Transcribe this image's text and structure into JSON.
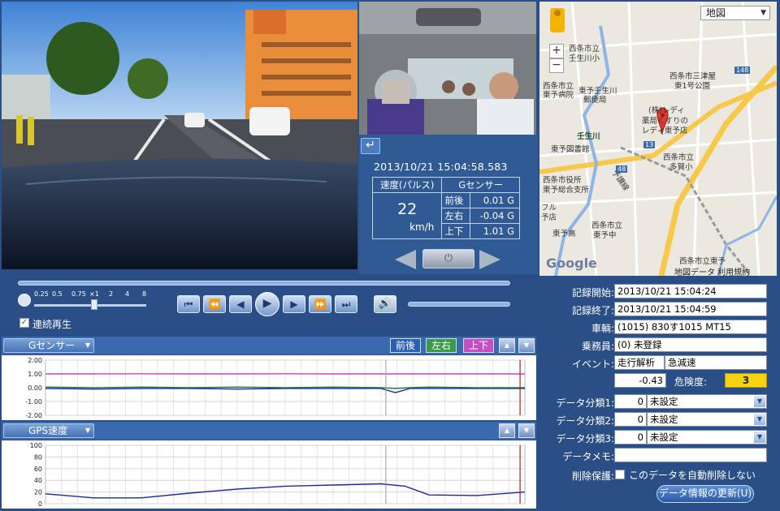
{
  "info": {
    "datetime": "2013/10/21   15:04:58.583",
    "speed_header": "速度(パルス)",
    "speed_value": "22",
    "speed_unit": "km/h",
    "gsensor_header": "Gセンサー",
    "rows": [
      {
        "label": "前後",
        "value": "0.01 G"
      },
      {
        "label": "左右",
        "value": "-0.04 G"
      },
      {
        "label": "上下",
        "value": "1.01 G"
      }
    ],
    "back_icon": "return-arrow-icon",
    "home_icon": "power-icon"
  },
  "map": {
    "type_select": "地図",
    "zoom_in": "+",
    "zoom_out": "−",
    "labels": [
      {
        "text": "西条市立"
      },
      {
        "text": "壬生川小"
      },
      {
        "text": "西条市立"
      },
      {
        "text": "東予病院"
      },
      {
        "text": "東予壬生川"
      },
      {
        "text": "郵便局"
      },
      {
        "text": "西条市三津屋"
      },
      {
        "text": "東1号公園"
      },
      {
        "text": "(株)レディ"
      },
      {
        "text": "薬局くすりの"
      },
      {
        "text": "レディ東予店"
      },
      {
        "text": "壬生川"
      },
      {
        "text": "東予図書館"
      },
      {
        "text": "西条市立"
      },
      {
        "text": "多賀小"
      },
      {
        "text": "西条市役所"
      },
      {
        "text": "東予総合支所"
      },
      {
        "text": "フル"
      },
      {
        "text": "予店"
      },
      {
        "text": "西条市立"
      },
      {
        "text": "東予中"
      },
      {
        "text": "東予高"
      },
      {
        "text": "西条市立東予"
      },
      {
        "text": "予讃線"
      },
      {
        "text": "148"
      },
      {
        "text": "13"
      },
      {
        "text": "48"
      }
    ],
    "logo": "Google",
    "footer": "地図データ  利用規約"
  },
  "controls": {
    "speed_labels": [
      "0.25",
      "0.5",
      "0.75",
      "×1",
      "2",
      "4",
      "8"
    ],
    "buttons": [
      "⏮",
      "⏪",
      "◀",
      "▶",
      "⏩",
      "⏭"
    ],
    "play": "▶",
    "volume": "🔊",
    "continuous_label": "連続再生",
    "continuous_checked": "✓"
  },
  "chart_gsensor": {
    "select_label": "Gセンサー",
    "toggles": [
      "前後",
      "左右",
      "上下"
    ],
    "up": "▲",
    "down": "▼",
    "y_labels": [
      "2.00",
      "1.00",
      "0.00",
      "-1.00",
      "-2.00"
    ]
  },
  "chart_gps": {
    "select_label": "GPS速度",
    "up": "▲",
    "down": "▼",
    "y_labels": [
      "100",
      "80",
      "60",
      "40",
      "20",
      "0"
    ]
  },
  "chart_data": [
    {
      "type": "line",
      "title": "Gセンサー",
      "ylim": [
        -2,
        2
      ],
      "yticks": [
        2.0,
        1.0,
        0.0,
        -1.0,
        -2.0
      ],
      "grid": true,
      "cursor_x": 0.71,
      "end_marker_x": 0.99,
      "x": [
        0,
        0.1,
        0.2,
        0.3,
        0.4,
        0.5,
        0.6,
        0.7,
        0.73,
        0.76,
        0.8,
        0.9,
        1.0
      ],
      "series": [
        {
          "name": "上下",
          "color": "#d040c0",
          "values": [
            1.0,
            1.0,
            1.01,
            1.0,
            1.0,
            1.01,
            1.0,
            1.0,
            1.0,
            1.0,
            1.0,
            1.0,
            1.0
          ]
        },
        {
          "name": "前後",
          "color": "#1a2a9e",
          "values": [
            -0.05,
            -0.1,
            -0.05,
            -0.05,
            -0.1,
            -0.05,
            -0.05,
            -0.05,
            -0.35,
            -0.05,
            -0.05,
            -0.05,
            -0.05
          ]
        },
        {
          "name": "左右",
          "color": "#1f7a3a",
          "values": [
            0.05,
            0.0,
            0.05,
            0.0,
            0.05,
            0.0,
            0.05,
            0.0,
            -0.05,
            0.0,
            0.05,
            0.0,
            0.0
          ]
        }
      ]
    },
    {
      "type": "line",
      "title": "GPS速度",
      "ylim": [
        0,
        100
      ],
      "yticks": [
        100,
        80,
        60,
        40,
        20,
        0
      ],
      "grid": true,
      "cursor_x": 0.71,
      "end_marker_x": 0.99,
      "x": [
        0,
        0.1,
        0.2,
        0.3,
        0.4,
        0.5,
        0.6,
        0.7,
        0.75,
        0.8,
        0.9,
        1.0
      ],
      "series": [
        {
          "name": "GPS速度",
          "color": "#1a2a9e",
          "values": [
            17,
            10,
            10,
            18,
            25,
            30,
            32,
            34,
            30,
            15,
            14,
            20
          ]
        }
      ]
    }
  ],
  "form": {
    "fields": [
      {
        "label": "記録開始:",
        "value": "2013/10/21 15:04:24"
      },
      {
        "label": "記録終了:",
        "value": "2013/10/21 15:04:59"
      },
      {
        "label": "車輌:",
        "value": "(1015) 830す1015   MT15"
      },
      {
        "label": "乗務員:",
        "value": "(0) 未登録"
      }
    ],
    "event_label": "イベント:",
    "event_type": "走行解析",
    "event_detail": "急減速",
    "event_value": "-0.43",
    "risk_label": "危険度:",
    "risk_value": "3",
    "categories": [
      {
        "label": "データ分類1:",
        "num": "0",
        "value": "未設定"
      },
      {
        "label": "データ分類2:",
        "num": "0",
        "value": "未設定"
      },
      {
        "label": "データ分類3:",
        "num": "0",
        "value": "未設定"
      }
    ],
    "memo_label": "データメモ:",
    "memo_value": "",
    "protect_label": "削除保護:",
    "protect_text": "このデータを自動削除しない",
    "update_button": "データ情報の更新(U)"
  }
}
